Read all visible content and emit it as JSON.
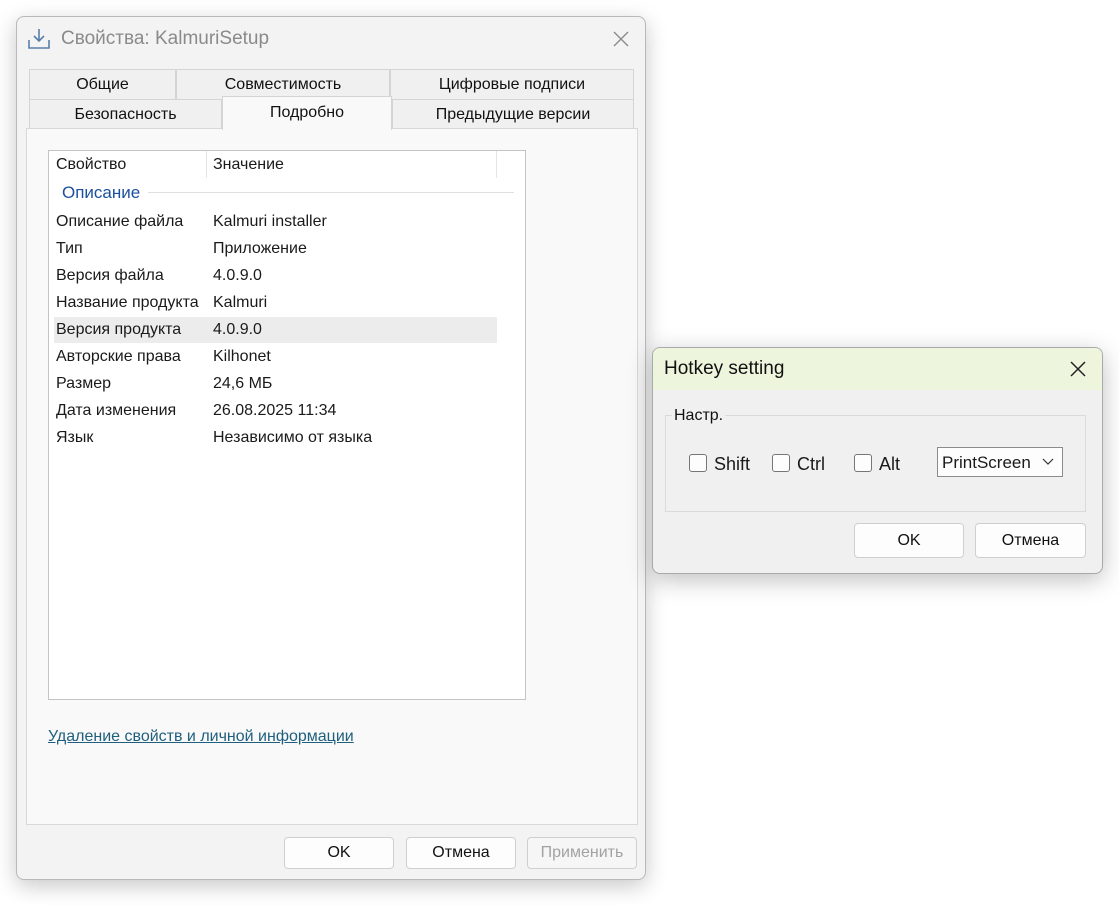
{
  "props_window": {
    "title": "Свойства: KalmuriSetup",
    "tabs_row1": [
      "Общие",
      "Совместимость",
      "Цифровые подписи"
    ],
    "tabs_row2": [
      "Безопасность",
      "Подробно",
      "Предыдущие версии"
    ],
    "active_tab": "Подробно",
    "columns": {
      "property": "Свойство",
      "value": "Значение"
    },
    "group": "Описание",
    "rows": [
      {
        "key": "Описание файла",
        "value": "Kalmuri installer"
      },
      {
        "key": "Тип",
        "value": "Приложение"
      },
      {
        "key": "Версия файла",
        "value": "4.0.9.0"
      },
      {
        "key": "Название продукта",
        "value": "Kalmuri"
      },
      {
        "key": "Версия продукта",
        "value": "4.0.9.0",
        "selected": true
      },
      {
        "key": "Авторские права",
        "value": "Kilhonet"
      },
      {
        "key": "Размер",
        "value": "24,6 МБ"
      },
      {
        "key": "Дата изменения",
        "value": "26.08.2025 11:34"
      },
      {
        "key": "Язык",
        "value": "Независимо от языка"
      }
    ],
    "remove_link": "Удаление свойств и личной информации",
    "buttons": {
      "ok": "OK",
      "cancel": "Отмена",
      "apply": "Применить"
    }
  },
  "hotkey_dialog": {
    "title": "Hotkey setting",
    "group_label": "Настр.",
    "checkboxes": [
      {
        "label": "Shift",
        "checked": false
      },
      {
        "label": "Ctrl",
        "checked": false
      },
      {
        "label": "Alt",
        "checked": false
      }
    ],
    "key_select": "PrintScreen",
    "buttons": {
      "ok": "OK",
      "cancel": "Отмена"
    }
  },
  "icons": {
    "window_icon": "download-tray-icon",
    "close": "close-icon",
    "dropdown": "chevron-down-icon"
  },
  "colors": {
    "group_label": "#1c4f9e",
    "link": "#1f5f7e",
    "hotkey_titlebar": "#eef5dd",
    "selected_row": "#ececec"
  }
}
